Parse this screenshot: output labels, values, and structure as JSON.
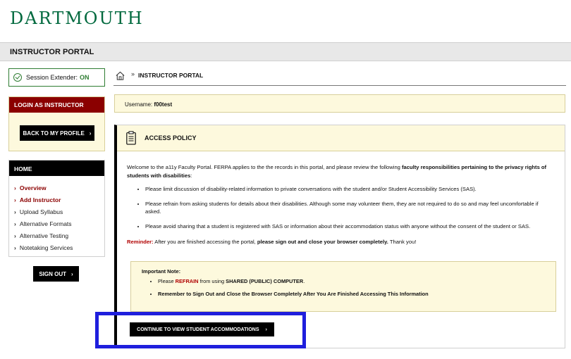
{
  "logo": "DARTMOUTH",
  "portal_title": "INSTRUCTOR PORTAL",
  "session": {
    "label": "Session Extender:",
    "status": "ON"
  },
  "login": {
    "header": "LOGIN AS INSTRUCTOR",
    "back_button": "BACK TO MY PROFILE"
  },
  "menu": {
    "header": "HOME",
    "items": [
      {
        "label": "Overview",
        "active": true
      },
      {
        "label": "Add Instructor",
        "active": true
      },
      {
        "label": "Upload Syllabus",
        "active": false
      },
      {
        "label": "Alternative Formats",
        "active": false
      },
      {
        "label": "Alternative Testing",
        "active": false
      },
      {
        "label": "Notetaking Services",
        "active": false
      }
    ]
  },
  "signout_label": "SIGN OUT",
  "breadcrumb": {
    "separator": "»",
    "current": "INSTRUCTOR PORTAL"
  },
  "user": {
    "label": "Username:",
    "value": "f00test"
  },
  "policy": {
    "title": "ACCESS POLICY",
    "intro_text": "Welcome to the a11y Faculty Portal. FERPA applies to the the records in this portal, and please review the following ",
    "intro_bold": "faculty responsibilities pertaining to the privacy rights of students with disabilities",
    "intro_end": ":",
    "bullets": [
      "Please limit discussion of disability-related information to private conversations with the student and/or Student Accessibility Services (SAS).",
      "Please refrain from asking students for details about their disabilities. Although some may volunteer them, they are not required to do so and may feel uncomfortable if asked.",
      "Please avoid sharing that a student is registered with SAS or information about their accommodation status with anyone without the consent of the student or SAS."
    ],
    "reminder_label": "Reminder:",
    "reminder_text": " After you are finished accessing the portal, ",
    "reminder_bold": "please sign out and close your browser completely.",
    "reminder_end": " Thank you!"
  },
  "note": {
    "title": "Important Note",
    "line1_pre": "Please ",
    "line1_refrain": "REFRAIN",
    "line1_mid": " from using ",
    "line1_bold": "SHARED (PUBLIC) COMPUTER",
    "line1_end": ".",
    "line2": "Remember to Sign Out and Close the Browser Completely After You Are Finished Accessing This Information"
  },
  "continue_label": "CONTINUE TO VIEW STUDENT ACCOMMODATIONS",
  "colors": {
    "green": "#00693e",
    "maroon": "#8b0000",
    "highlight": "#1f1fdd",
    "cream": "#fdf9dd"
  }
}
